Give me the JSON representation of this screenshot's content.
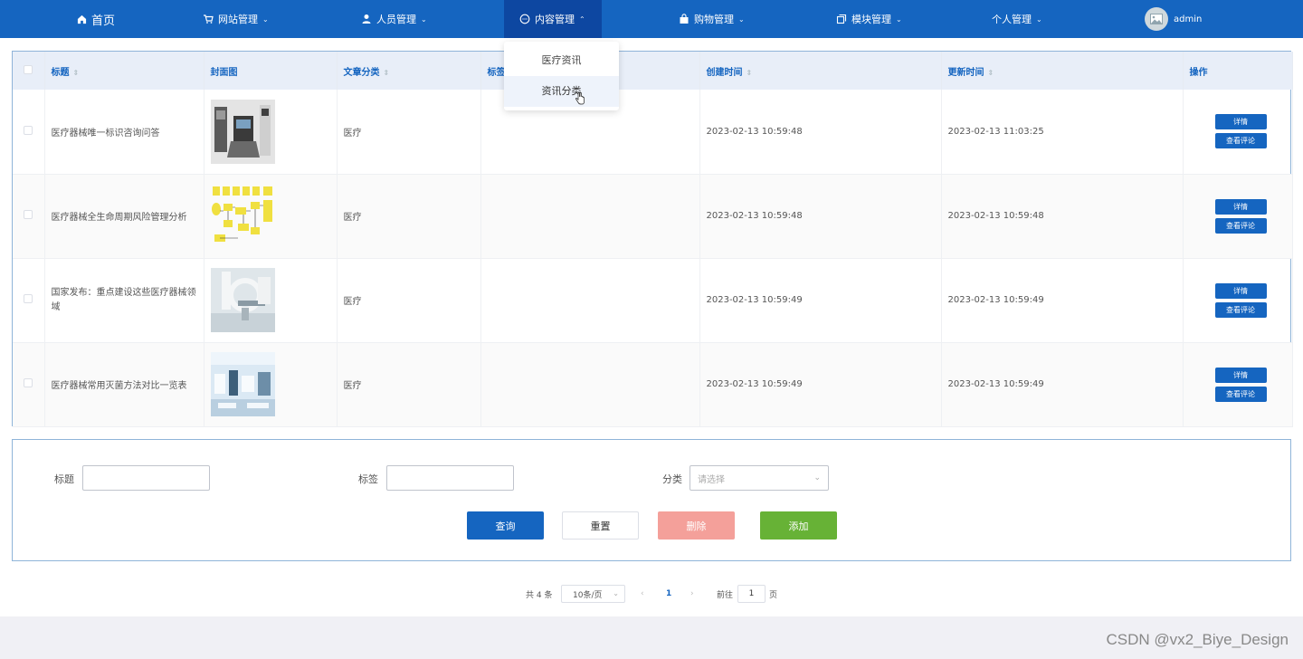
{
  "nav": {
    "home": "首页",
    "items": [
      {
        "label": "网站管理"
      },
      {
        "label": "人员管理"
      },
      {
        "label": "内容管理"
      },
      {
        "label": "购物管理"
      },
      {
        "label": "模块管理"
      },
      {
        "label": "个人管理"
      }
    ],
    "user": "admin",
    "color": "#1565c0"
  },
  "dropdown": {
    "items": [
      "医疗资讯",
      "资讯分类"
    ]
  },
  "table": {
    "headers": [
      "标题",
      "封面图",
      "文章分类",
      "标签",
      "创建时间",
      "更新时间",
      "操作"
    ],
    "rows": [
      {
        "title": "医疗器械唯一标识咨询问答",
        "category": "医疗",
        "created": "2023-02-13 10:59:48",
        "updated": "2023-02-13 11:03:25"
      },
      {
        "title": "医疗器械全生命周期风险管理分析",
        "category": "医疗",
        "created": "2023-02-13 10:59:48",
        "updated": "2023-02-13 10:59:48"
      },
      {
        "title": "国家发布：重点建设这些医疗器械领域",
        "category": "医疗",
        "created": "2023-02-13 10:59:49",
        "updated": "2023-02-13 10:59:49"
      },
      {
        "title": "医疗器械常用灭菌方法对比一览表",
        "category": "医疗",
        "created": "2023-02-13 10:59:49",
        "updated": "2023-02-13 10:59:49"
      }
    ],
    "op_detail": "详情",
    "op_comments": "查看评论"
  },
  "form": {
    "title_label": "标题",
    "tag_label": "标签",
    "category_label": "分类",
    "category_placeholder": "请选择",
    "buttons": {
      "query": "查询",
      "reset": "重置",
      "delete": "删除",
      "add": "添加"
    },
    "colors": {
      "query": "#1565c0",
      "delete": "#f4a09a",
      "add": "#67b236"
    }
  },
  "pagination": {
    "total": "共 4 条",
    "page_size": "10条/页",
    "current": "1",
    "goto": "前往",
    "goto_value": "1",
    "page_unit": "页"
  },
  "watermark": "CSDN @vx2_Biye_Design"
}
